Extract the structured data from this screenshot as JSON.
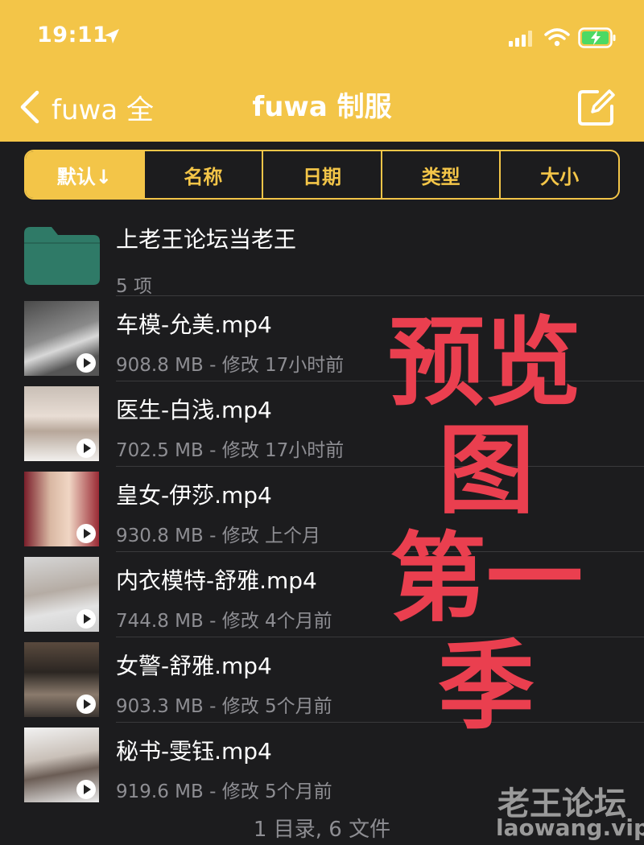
{
  "status_bar": {
    "time": "19:11"
  },
  "nav": {
    "back_label": "fuwa 全",
    "title": "fuwa 制服"
  },
  "sort_tabs": [
    "默认↓",
    "名称",
    "日期",
    "类型",
    "大小"
  ],
  "folder": {
    "name": "上老王论坛当老王",
    "count": "5 项"
  },
  "files": [
    {
      "name": "车模-允美.mp4",
      "meta": "908.8 MB - 修改 17小时前"
    },
    {
      "name": "医生-白浅.mp4",
      "meta": "702.5 MB - 修改 17小时前"
    },
    {
      "name": "皇女-伊莎.mp4",
      "meta": "930.8 MB - 修改 上个月"
    },
    {
      "name": "内衣模特-舒雅.mp4",
      "meta": "744.8 MB - 修改 4个月前"
    },
    {
      "name": "女警-舒雅.mp4",
      "meta": "903.3 MB - 修改 5个月前"
    },
    {
      "name": "秘书-雯钰.mp4",
      "meta": "919.6 MB - 修改 5个月前"
    }
  ],
  "overlay_text": {
    "line1": "预览",
    "line2": "图",
    "line3": "第一",
    "line4": "季"
  },
  "footer": "1 目录, 6 文件",
  "watermark": {
    "title": "老王论坛",
    "url": "laowang.vip"
  },
  "colors": {
    "accent": "#f3c548",
    "background": "#1c1c1e",
    "folder": "#2f7a67",
    "overlay": "#ea3f4f"
  }
}
